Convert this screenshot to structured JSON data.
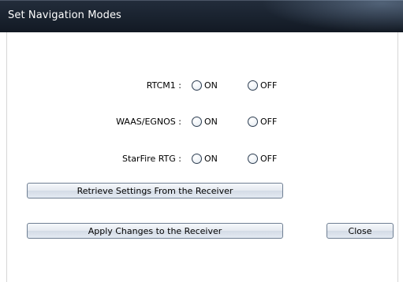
{
  "window": {
    "title": "Set Navigation Modes"
  },
  "modes": [
    {
      "label": "RTCM1 :",
      "on_label": "ON",
      "off_label": "OFF"
    },
    {
      "label": "WAAS/EGNOS :",
      "on_label": "ON",
      "off_label": "OFF"
    },
    {
      "label": "StarFire RTG :",
      "on_label": "ON",
      "off_label": "OFF"
    }
  ],
  "buttons": {
    "retrieve": "Retrieve Settings From the Receiver",
    "apply": "Apply Changes to the Receiver",
    "close": "Close"
  }
}
